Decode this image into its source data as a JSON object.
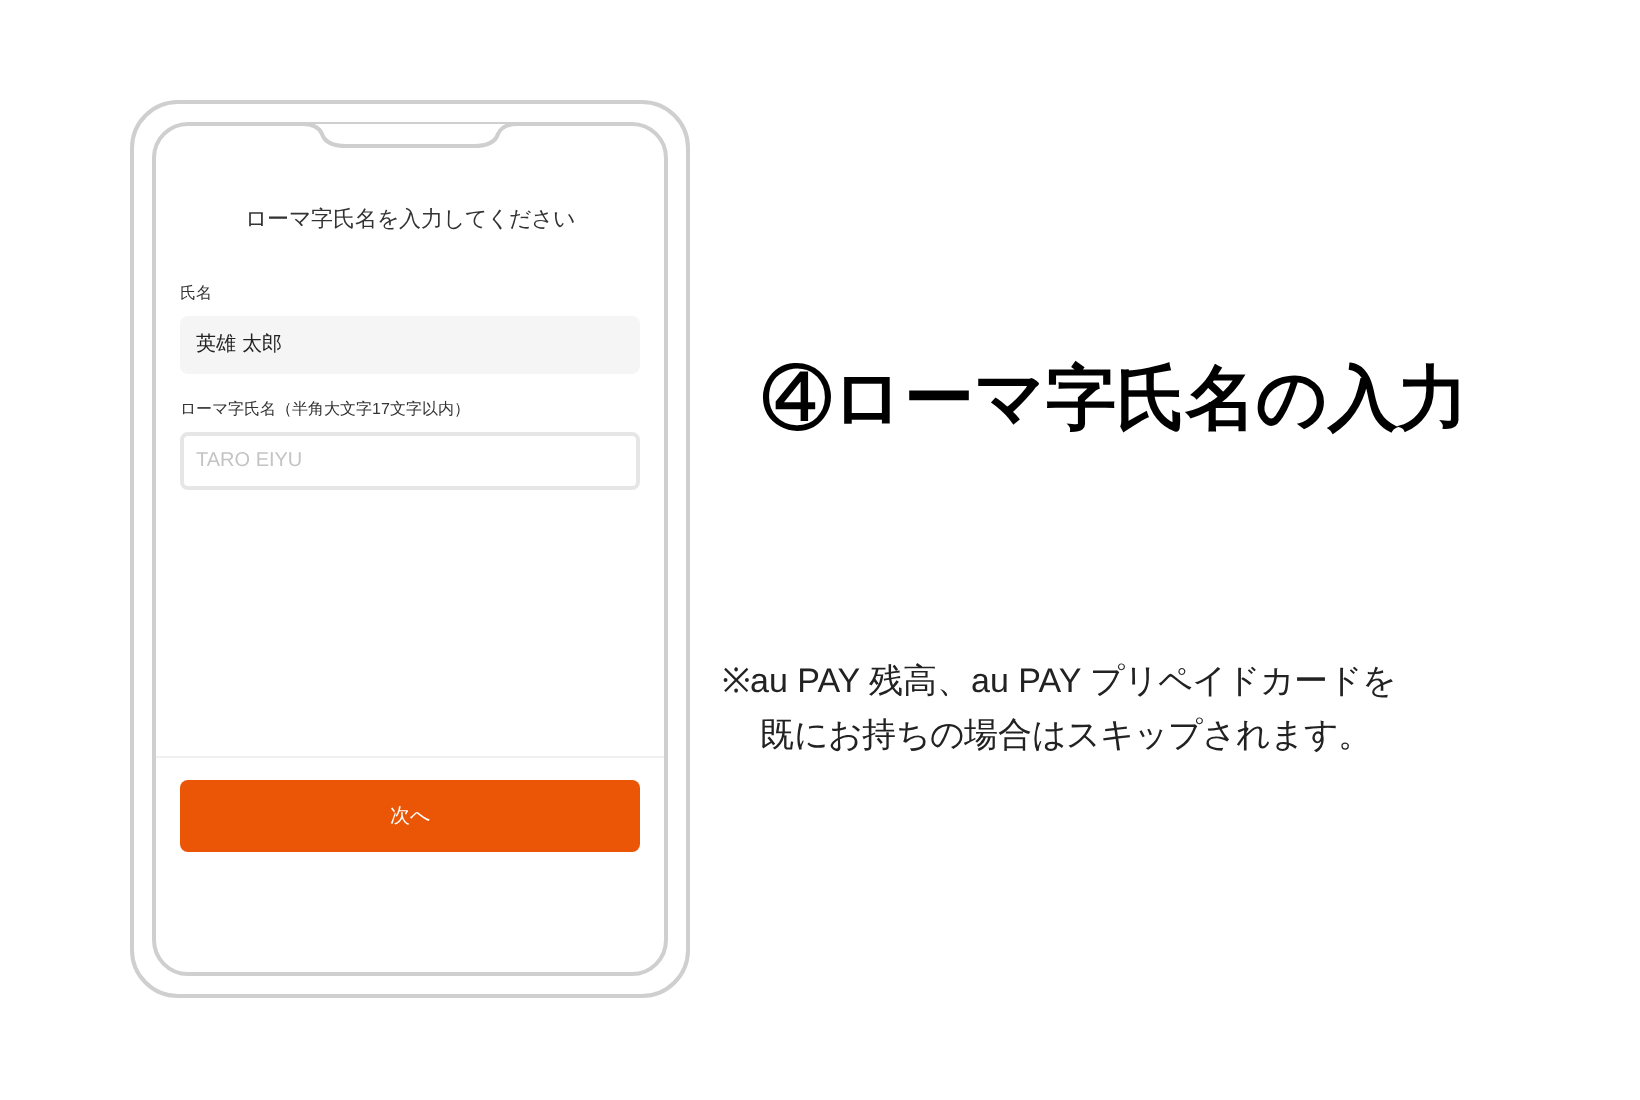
{
  "phone_screen": {
    "heading": "ローマ字氏名を入力してください",
    "fields": [
      {
        "label": "氏名",
        "value": "英雄 太郎",
        "filled": true
      },
      {
        "label": "ローマ字氏名（半角大文字17文字以内）",
        "placeholder": "TARO EIYU",
        "filled": false
      }
    ],
    "next_button": "次へ"
  },
  "title": "④ローマ字氏名の入力",
  "note_lines": [
    "※au PAY 残高、au PAY プリペイドカードを",
    "既にお持ちの場合はスキップされます。"
  ]
}
